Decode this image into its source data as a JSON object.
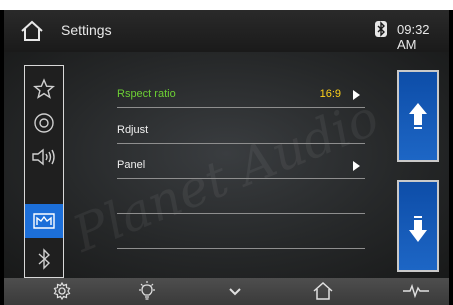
{
  "header": {
    "title": "Settings",
    "time": "09:32 AM"
  },
  "menu": {
    "items": [
      {
        "name": "favorites",
        "icon": "star-icon",
        "active": false
      },
      {
        "name": "disc",
        "icon": "disc-icon",
        "active": false
      },
      {
        "name": "audio",
        "icon": "speaker-icon",
        "active": false
      },
      {
        "name": "display",
        "icon": "display-icon",
        "active": true
      },
      {
        "name": "bluetooth",
        "icon": "bluetooth-icon",
        "active": false
      }
    ]
  },
  "settings": {
    "rows": [
      {
        "label": "Rspect ratio",
        "value": "16:9",
        "has_arrow": true,
        "highlight": true
      },
      {
        "label": "Rdjust",
        "value": "",
        "has_arrow": false,
        "highlight": false
      },
      {
        "label": "Panel",
        "value": "",
        "has_arrow": true,
        "highlight": false
      },
      {
        "label": "",
        "value": "",
        "has_arrow": false,
        "highlight": false
      },
      {
        "label": "",
        "value": "",
        "has_arrow": false,
        "highlight": false
      }
    ]
  },
  "bottom_bar": {
    "icons": [
      "settings-gear-icon",
      "light-bulb-icon",
      "chevron-down-icon",
      "home-icon",
      "equalizer-icon"
    ]
  },
  "colors": {
    "accent": "#1c6fd9",
    "highlight_label": "#6ccf34",
    "value_text": "#ffd21a"
  }
}
